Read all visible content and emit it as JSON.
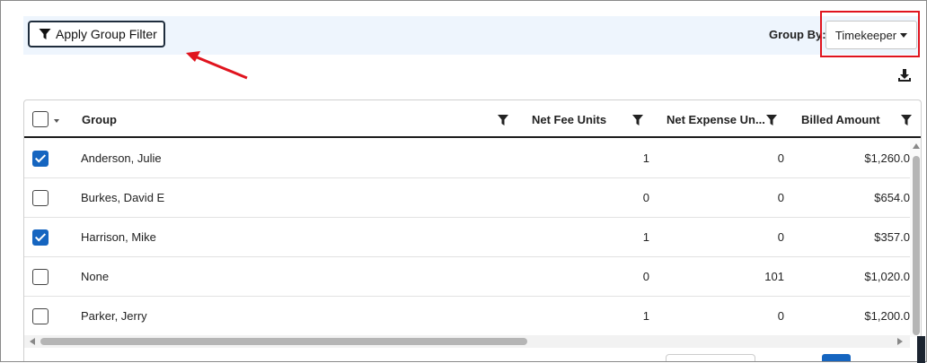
{
  "toolbar": {
    "apply_group_filter_label": "Apply Group Filter",
    "group_by_label": "Group By:",
    "group_by_value": "Timekeeper"
  },
  "grid": {
    "columns": [
      {
        "label": "Group"
      },
      {
        "label": "Net Fee Units"
      },
      {
        "label": "Net Expense Un..."
      },
      {
        "label": "Billed Amount"
      }
    ],
    "rows": [
      {
        "checked": true,
        "group": "Anderson, Julie",
        "net_fee_units": "1",
        "net_expense_units": "0",
        "billed_amount": "$1,260.0"
      },
      {
        "checked": false,
        "group": "Burkes, David E",
        "net_fee_units": "0",
        "net_expense_units": "0",
        "billed_amount": "$654.0"
      },
      {
        "checked": true,
        "group": "Harrison, Mike",
        "net_fee_units": "1",
        "net_expense_units": "0",
        "billed_amount": "$357.0"
      },
      {
        "checked": false,
        "group": "None",
        "net_fee_units": "0",
        "net_expense_units": "101",
        "billed_amount": "$1,020.0"
      },
      {
        "checked": false,
        "group": "Parker, Jerry",
        "net_fee_units": "1",
        "net_expense_units": "0",
        "billed_amount": "$1,200.0"
      }
    ]
  },
  "icons": {
    "filter": "filter-icon",
    "download": "download-icon",
    "annotation_arrow": "arrow-icon"
  },
  "colors": {
    "accent": "#1565c0",
    "highlight": "#e0141e",
    "toolbar_bg": "#eef5fd"
  }
}
